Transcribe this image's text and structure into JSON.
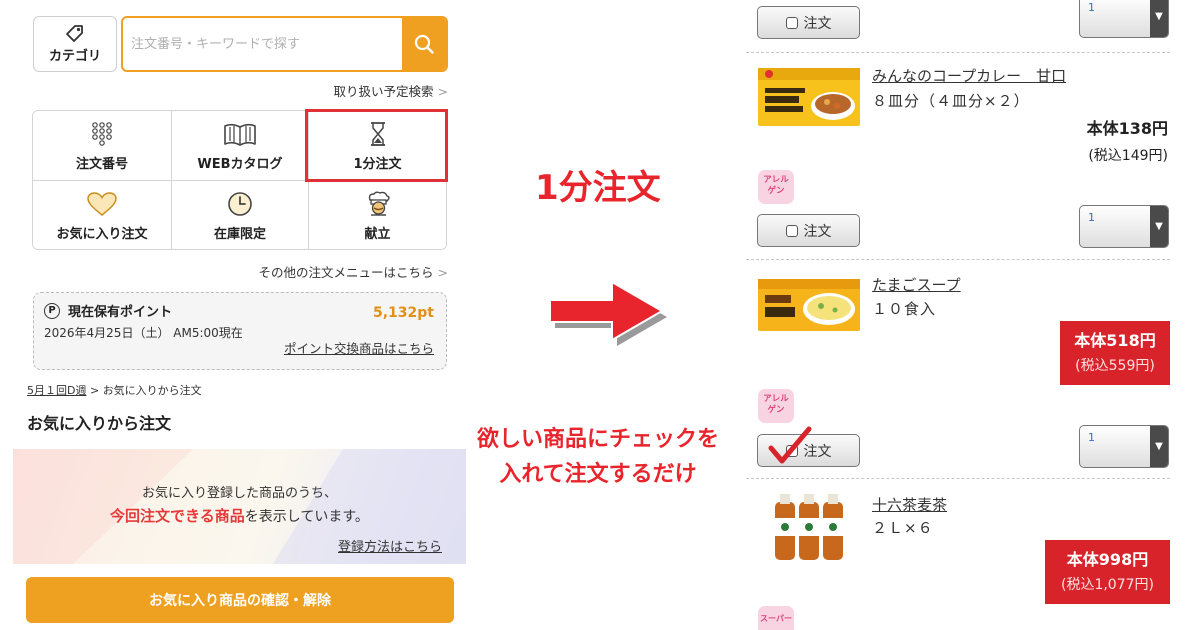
{
  "header": {
    "category_label": "カテゴリ",
    "search_placeholder": "注文番号・キーワードで探す",
    "scheduled_search_link": "取り扱い予定検索"
  },
  "menu": {
    "items": [
      {
        "label": "注文番号",
        "icon": "keypad-icon"
      },
      {
        "label": "WEBカタログ",
        "icon": "book-icon"
      },
      {
        "label": "1分注文",
        "icon": "hourglass-icon"
      },
      {
        "label": "お気に入り注文",
        "icon": "heart-icon"
      },
      {
        "label": "在庫限定",
        "icon": "clock-icon"
      },
      {
        "label": "献立",
        "icon": "chef-icon"
      }
    ],
    "other_menu_link": "その他の注文メニューはこちら"
  },
  "points": {
    "title": "現在保有ポイント",
    "value": "5,132pt",
    "date": "2026年4月25日（土） AM5:00現在",
    "exchange_link": "ポイント交換商品はこちら"
  },
  "breadcrumb": {
    "week": "5月１回D週",
    "separator": ">",
    "current": "お気に入りから注文"
  },
  "favorites": {
    "title": "お気に入りから注文",
    "banner_line1": "お気に入り登録した商品のうち、",
    "banner_highlight": "今回注文できる商品",
    "banner_rest": "を表示しています。",
    "register_link": "登録方法はこちら",
    "confirm_button": "お気に入り商品の確認・解除"
  },
  "annotations": {
    "headline": "1分注文",
    "note_line1": "欲しい商品にチェックを",
    "note_line2": "入れて注文するだけ"
  },
  "products": {
    "order_label": "注文",
    "allergy_label_line1": "アレル",
    "allergy_label_line2": "ゲン",
    "super_label": "スーパー",
    "items": [
      {
        "name": "みんなのコープカレー　甘口",
        "size": "８皿分（４皿分×２）",
        "price": "本体138円",
        "tax": "(税込149円)",
        "qty": "1",
        "highlight": false
      },
      {
        "name": "たまごスープ",
        "size": "１０食入",
        "price": "本体518円",
        "tax": "(税込559円)",
        "qty": "1",
        "highlight": true
      },
      {
        "name": "十六茶麦茶",
        "size": "２Ｌ×６",
        "price": "本体998円",
        "tax": "(税込1,077円)",
        "qty": "1",
        "highlight": true
      }
    ],
    "top_qty": "1"
  },
  "colors": {
    "orange": "#f0a020",
    "red": "#e8242c",
    "price_red": "#d8232a"
  }
}
